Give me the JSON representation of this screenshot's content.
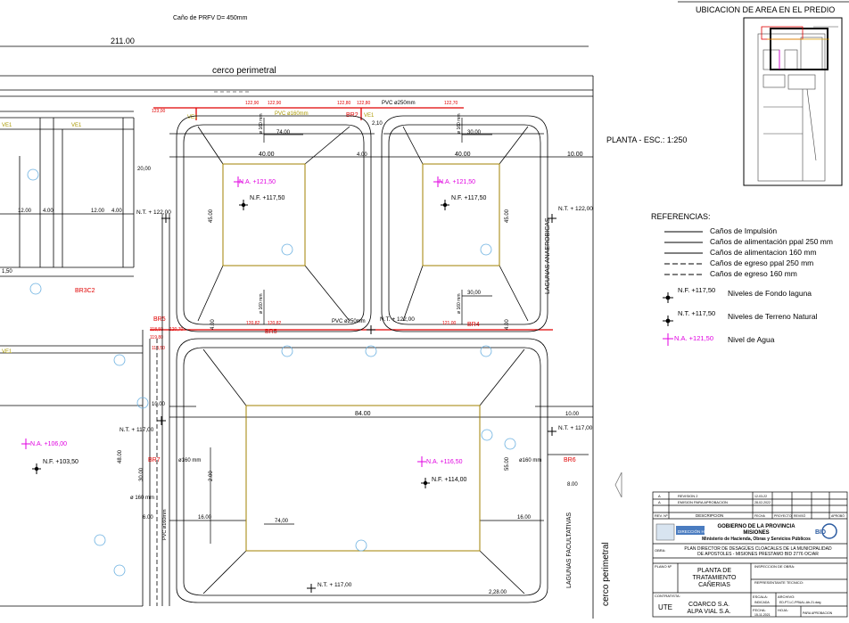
{
  "header": {
    "pipe_note": "Caño de PRFV D= 450mm",
    "dim_total": "211.00",
    "perimeter": "cerco perimetral",
    "location_title": "UBICACION DE AREA EN EL PREDIO",
    "plan_title": "PLANTA -  ESC.: 1:250"
  },
  "pipe_labels": {
    "pvc250_top": "PVC ø250mm",
    "pvc160_top": "PVC ø160mm",
    "pvc250_mid": "PVC ø250mm",
    "d160a": "ø 160 mm",
    "d160b": "ø 160 mm",
    "d160c": "ø 160 mm",
    "d160d": "ø 160 mm",
    "d160e": "ø160 mm",
    "d160f": "ø160 mm",
    "d160g": "ø 160 mm",
    "pvc_left": "PVC ø160mm"
  },
  "red_levels": [
    "123,00",
    "122,90",
    "122,90",
    "122,80",
    "122,80",
    "122,70",
    "120,82",
    "120,82",
    "121,00",
    "118,50",
    "120,70",
    "119,80",
    "118,50"
  ],
  "box_names": {
    "br2": "BR2",
    "br3c2": "BR3C2",
    "br5a": "BR5",
    "br5b": "BR5",
    "br4": "BR4",
    "br6": "BR6",
    "br7": "BR7",
    "br8": "BR8",
    "ve1a": "VE1",
    "ve1b": "VE1",
    "ve1c": "VE1",
    "ve1d": "VE1",
    "ve1e": "VE1"
  },
  "dims": {
    "d40a": "40.00",
    "d40b": "40.00",
    "d74a": "74,00",
    "d74b": "74,00",
    "d30a": "30,00",
    "d30b": "30,00",
    "d4a": "4.00",
    "d4b": "4.00",
    "d4c": "4.00",
    "d4d": "4.00",
    "d4e": "4.00",
    "d10a": "10.00",
    "d10b": "10.00",
    "d10c": "10.00",
    "d10d": "10.00",
    "d12a": "12.00",
    "d12b": "12.00",
    "d12c": "12.00",
    "d20": "20,00",
    "d150": "1,50",
    "d84": "84.00",
    "d16a": "16.00",
    "d16b": "16.00",
    "d6": "6.00",
    "d8": "8.00",
    "d45a": "45.00",
    "d45b": "45.00",
    "d55": "55.00",
    "d48": "48.00",
    "d30c": "30.00",
    "d228": "2,28.00",
    "d210": "2,10",
    "d2": "2.00"
  },
  "levels": {
    "na1": "N.A. +121,50",
    "nf1": "N.F. +117,50",
    "na2": "N.A. +121,50",
    "nf2": "N.F. +117,50",
    "nt1": "N.T. + 122,00",
    "nt2": "N.T. + 122,00",
    "nt3": "N.T. + 122,00",
    "na3": "N.A. +106,00",
    "nf3": "N.F. +103,50",
    "nt4": "N.T. + 117,00",
    "nt5": "N.T. + 117,00",
    "na4": "N.A. +116,50",
    "nf4": "N.F. +114,00",
    "nt6": "N.T. + 117,00"
  },
  "vertical_labels": {
    "anaerobic": "LAGUNAS ANAEROBICAS",
    "facultative": "LAGUNAS FACULTATIVAS",
    "perimeter_v": "cerco perimetral"
  },
  "legend": {
    "title": "REFERENCIAS:",
    "items": [
      "Caños de Impulsión",
      "Caños de alimentación ppal 250 mm",
      "Caños de alimentacion 160 mm",
      "Caños de egreso ppal 250 mm",
      "Caños de egreso 160 mm"
    ],
    "sym_nf_tag": "N.F. +117,50",
    "sym_nf_label": "Niveles de Fondo laguna",
    "sym_nt_tag": "N.T. +117,50",
    "sym_nt_label": "Niveles de Terreno Natural",
    "sym_na_tag": "N.A. +121,50",
    "sym_na_label": "Nivel de Agua"
  },
  "title_block": {
    "rev_a": "A",
    "rev_b": "A",
    "rev_label": "REVISION 2",
    "rev_issue": "EMISION PARA APROBACION",
    "rev_date1": "12-03-22",
    "rev_date2": "28-02-2022",
    "rev_no": "REV. Nº",
    "description": "DESCRIPCION",
    "date": "FECHA",
    "project": "PROYECTO",
    "review": "REVISÓ",
    "approve": "APROBÓ",
    "gov": "GOBIERNO DE LA PROVINCIA",
    "province": "MISIONES",
    "ministry": "Ministerio de Hacienda, Obras y Servicios Públicos",
    "logo_water": "DIRECCIÓN HÍDRICA",
    "logo_bid": "BID",
    "obra_label": "OBRA:",
    "obra_line1": "PLAN DIRECTOR DE DESAGÜES CLOACALES DE LA MUNICIPALIDAD",
    "obra_line2": "DE APOSTOLES - MISIONES PRESTAMO BID 2776 OC/AR",
    "plano_label": "PLANO Nº",
    "plano_line1": "PLANTA DE",
    "plano_line2": "TRATAMIENTO",
    "plano_line3": "CAÑERIAS",
    "inspection": "INSPECCION DE OBRA:",
    "tech_rep": "REPRESENTANTE TECNICO:",
    "contractor": "CONTRATISTA:",
    "contractor_name": "UTE",
    "company1": "COARCO S.A.",
    "company2": "ALPA VIAL S.A.",
    "scale": "ESCALA:",
    "scale_val": "INDICADA",
    "file_label": "ARCHIVO:",
    "file_val": "ED-PT-LC-PR&AL-Ab-21.dwg",
    "date2": "FECHA:",
    "date2_val": "15-11-2021",
    "sheet": "HOJA:",
    "approval": "PARA APROBACION"
  }
}
